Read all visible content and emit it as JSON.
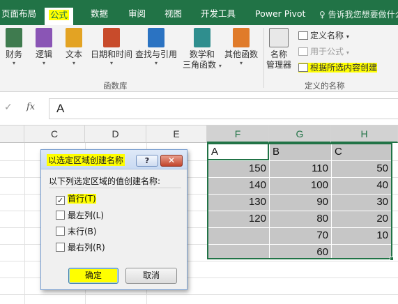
{
  "ribbon_tabs": [
    {
      "label": "页面布局"
    },
    {
      "label": "公式"
    },
    {
      "label": "数据"
    },
    {
      "label": "审阅"
    },
    {
      "label": "视图"
    },
    {
      "label": "开发工具"
    },
    {
      "label": "Power Pivot"
    }
  ],
  "tell_me": "♀ 告诉我您想要做什么",
  "function_library": {
    "group_label": "函数库",
    "buttons": [
      {
        "label": "财务",
        "icon": "finance-icon",
        "color": "#3f7b4f"
      },
      {
        "label": "逻辑",
        "icon": "logic-icon",
        "color": "#8a55b5"
      },
      {
        "label": "文本",
        "icon": "text-icon",
        "color": "#e3a323"
      },
      {
        "label": "日期和时间",
        "icon": "calendar-icon",
        "color": "#c84b2b"
      },
      {
        "label": "查找与引用",
        "icon": "lookup-icon",
        "color": "#2b73c2"
      },
      {
        "label": "数学和",
        "label2": "三角函数",
        "icon": "math-icon",
        "color": "#2f8e8e"
      },
      {
        "label": "其他函数",
        "icon": "more-functions-icon",
        "color": "#e07b2a"
      }
    ]
  },
  "defined_names": {
    "group_label": "定义的名称",
    "name_manager": {
      "label": "名称",
      "label2": "管理器"
    },
    "define_name": "定义名称",
    "use_in_formula": "用于公式",
    "create_from_selection": "根据所选内容创建"
  },
  "formula_bar": {
    "check": "✓",
    "fx": "fx",
    "value": "A"
  },
  "columns": [
    "C",
    "D",
    "E",
    "F",
    "G",
    "H"
  ],
  "cells": {
    "F": [
      "A",
      "150",
      "140",
      "130",
      "120",
      "",
      ""
    ],
    "G": [
      "B",
      "110",
      "100",
      "90",
      "80",
      "70",
      "60"
    ],
    "H": [
      "C",
      "50",
      "40",
      "30",
      "20",
      "10",
      ""
    ]
  },
  "dialog": {
    "title": "以选定区域创建名称",
    "help": "?",
    "close": "✕",
    "prompt": "以下列选定区域的值创建名称:",
    "options": [
      {
        "label": "首行(T)",
        "checked": true
      },
      {
        "label": "最左列(L)",
        "checked": false
      },
      {
        "label": "末行(B)",
        "checked": false
      },
      {
        "label": "最右列(R)",
        "checked": false
      }
    ],
    "ok": "确定",
    "cancel": "取消"
  }
}
